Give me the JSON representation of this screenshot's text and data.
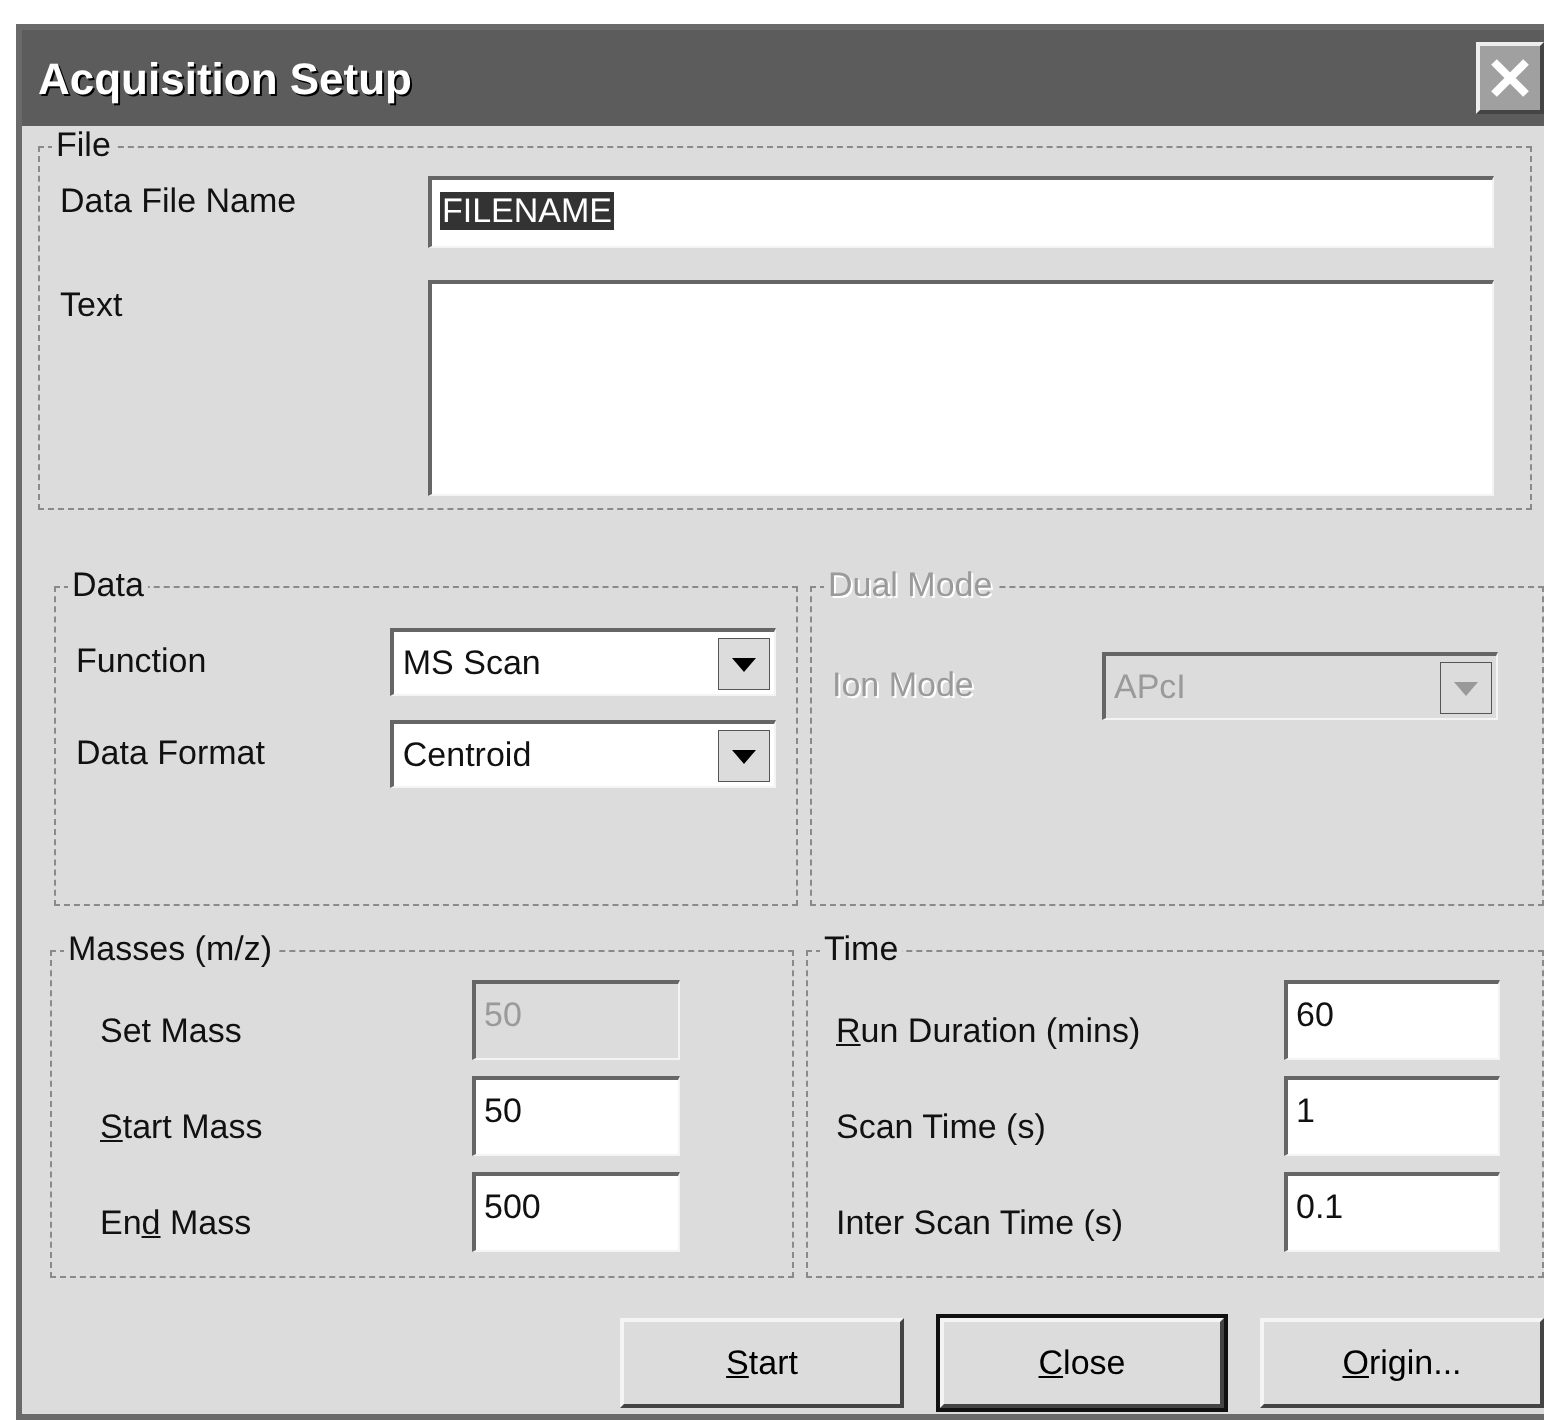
{
  "window": {
    "title": "Acquisition Setup"
  },
  "file_group": {
    "title": "File",
    "disabled": false,
    "fields": [
      {
        "kind": "line",
        "label": "Data File Name",
        "value": "FILENAME",
        "highlighted": true
      },
      {
        "kind": "area",
        "label": "Text"
      }
    ]
  },
  "data_group": {
    "title": "Data",
    "disabled": false,
    "fields": [
      {
        "label": "Function",
        "value": "MS Scan"
      },
      {
        "label": "Data Format",
        "value": "Centroid"
      }
    ]
  },
  "dual_mode_group": {
    "title": "Dual Mode",
    "disabled": true,
    "fields": [
      {
        "label": "Ion Mode",
        "value": "APcI"
      }
    ]
  },
  "masses_group": {
    "title": "Masses (m/z)",
    "disabled": false,
    "fields": [
      {
        "label": [
          {
            "text": "Set Mass",
            "underlined": false
          }
        ],
        "value": "50",
        "disabled": true
      },
      {
        "label": [
          {
            "text": "S",
            "underlined": true
          },
          {
            "text": "tart Mass",
            "underlined": false
          }
        ],
        "value": "50",
        "disabled": false
      },
      {
        "label": [
          {
            "text": "En",
            "underlined": false
          },
          {
            "text": "d",
            "underlined": true
          },
          {
            "text": " Mass",
            "underlined": false
          }
        ],
        "value": "500",
        "disabled": false
      }
    ]
  },
  "time_group": {
    "title": "Time",
    "disabled": false,
    "fields": [
      {
        "label": [
          {
            "text": "R",
            "underlined": true
          },
          {
            "text": "un Duration (mins)",
            "underlined": false
          }
        ],
        "value": "60",
        "disabled": false
      },
      {
        "label": [
          {
            "text": "Scan Time (s)",
            "underlined": false
          }
        ],
        "value": "1",
        "disabled": false
      },
      {
        "label": [
          {
            "text": "Inter Scan Time (s)",
            "underlined": false
          }
        ],
        "value": "0.1",
        "disabled": false
      }
    ]
  },
  "buttons": [
    {
      "label": [
        {
          "text": "S",
          "underlined": true
        },
        {
          "text": "tart",
          "underlined": false
        }
      ],
      "default": false
    },
    {
      "label": [
        {
          "text": "C",
          "underlined": true
        },
        {
          "text": "lose",
          "underlined": false
        }
      ],
      "default": true
    },
    {
      "label": [
        {
          "text": "O",
          "underlined": true
        },
        {
          "text": "rigin...",
          "underlined": false
        }
      ],
      "default": false
    }
  ]
}
